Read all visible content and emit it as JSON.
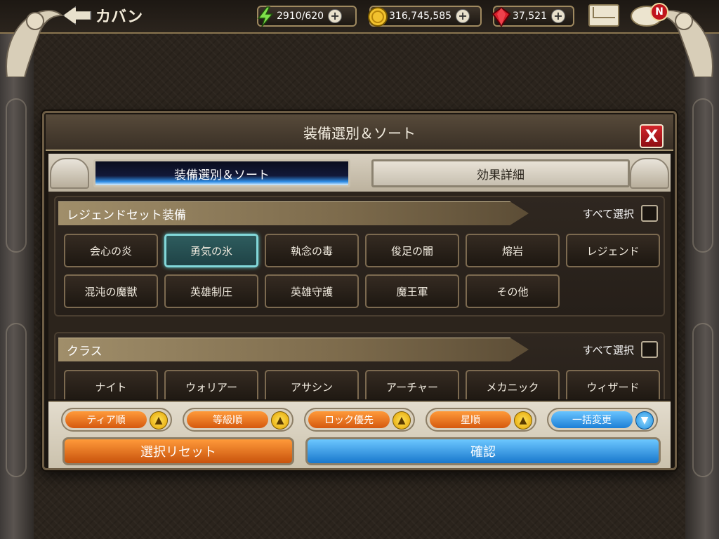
{
  "topbar": {
    "back_label": "カバン",
    "stamina": "2910/620",
    "gold": "316,745,585",
    "gems": "37,521",
    "notification_badge": "N"
  },
  "dialog": {
    "title": "装備選別＆ソート",
    "close_label": "X",
    "tabs": [
      {
        "label": "装備選別＆ソート",
        "active": true
      },
      {
        "label": "効果詳細",
        "active": false
      }
    ]
  },
  "legend_section": {
    "header": "レジェンドセット装備",
    "select_all": "すべて選択",
    "items": [
      {
        "label": "会心の炎",
        "selected": false
      },
      {
        "label": "勇気の氷",
        "selected": true
      },
      {
        "label": "執念の毒",
        "selected": false
      },
      {
        "label": "俊足の闇",
        "selected": false
      },
      {
        "label": "熔岩",
        "selected": false
      },
      {
        "label": "レジェンド",
        "selected": false
      },
      {
        "label": "混沌の魔獣",
        "selected": false
      },
      {
        "label": "英雄制圧",
        "selected": false
      },
      {
        "label": "英雄守護",
        "selected": false
      },
      {
        "label": "魔王軍",
        "selected": false
      },
      {
        "label": "その他",
        "selected": false
      }
    ]
  },
  "class_section": {
    "header": "クラス",
    "select_all": "すべて選択",
    "items": [
      {
        "label": "ナイト"
      },
      {
        "label": "ウォリアー"
      },
      {
        "label": "アサシン"
      },
      {
        "label": "アーチャー"
      },
      {
        "label": "メカニック"
      },
      {
        "label": "ウィザード"
      }
    ]
  },
  "sort_buttons": [
    {
      "label": "ティア順",
      "arrow": "▲",
      "color": "orange"
    },
    {
      "label": "等級順",
      "arrow": "▲",
      "color": "orange"
    },
    {
      "label": "ロック優先",
      "arrow": "▲",
      "color": "orange"
    },
    {
      "label": "星順",
      "arrow": "▲",
      "color": "orange"
    },
    {
      "label": "一括変更",
      "arrow": "▼",
      "color": "blue"
    }
  ],
  "actions": {
    "reset_label": "選択リセット",
    "confirm_label": "確認"
  },
  "colors": {
    "orange_button": "#e8761f",
    "blue_button": "#2f95e5",
    "selected_item_border": "#82d7d9",
    "close_button": "#c0141c"
  }
}
